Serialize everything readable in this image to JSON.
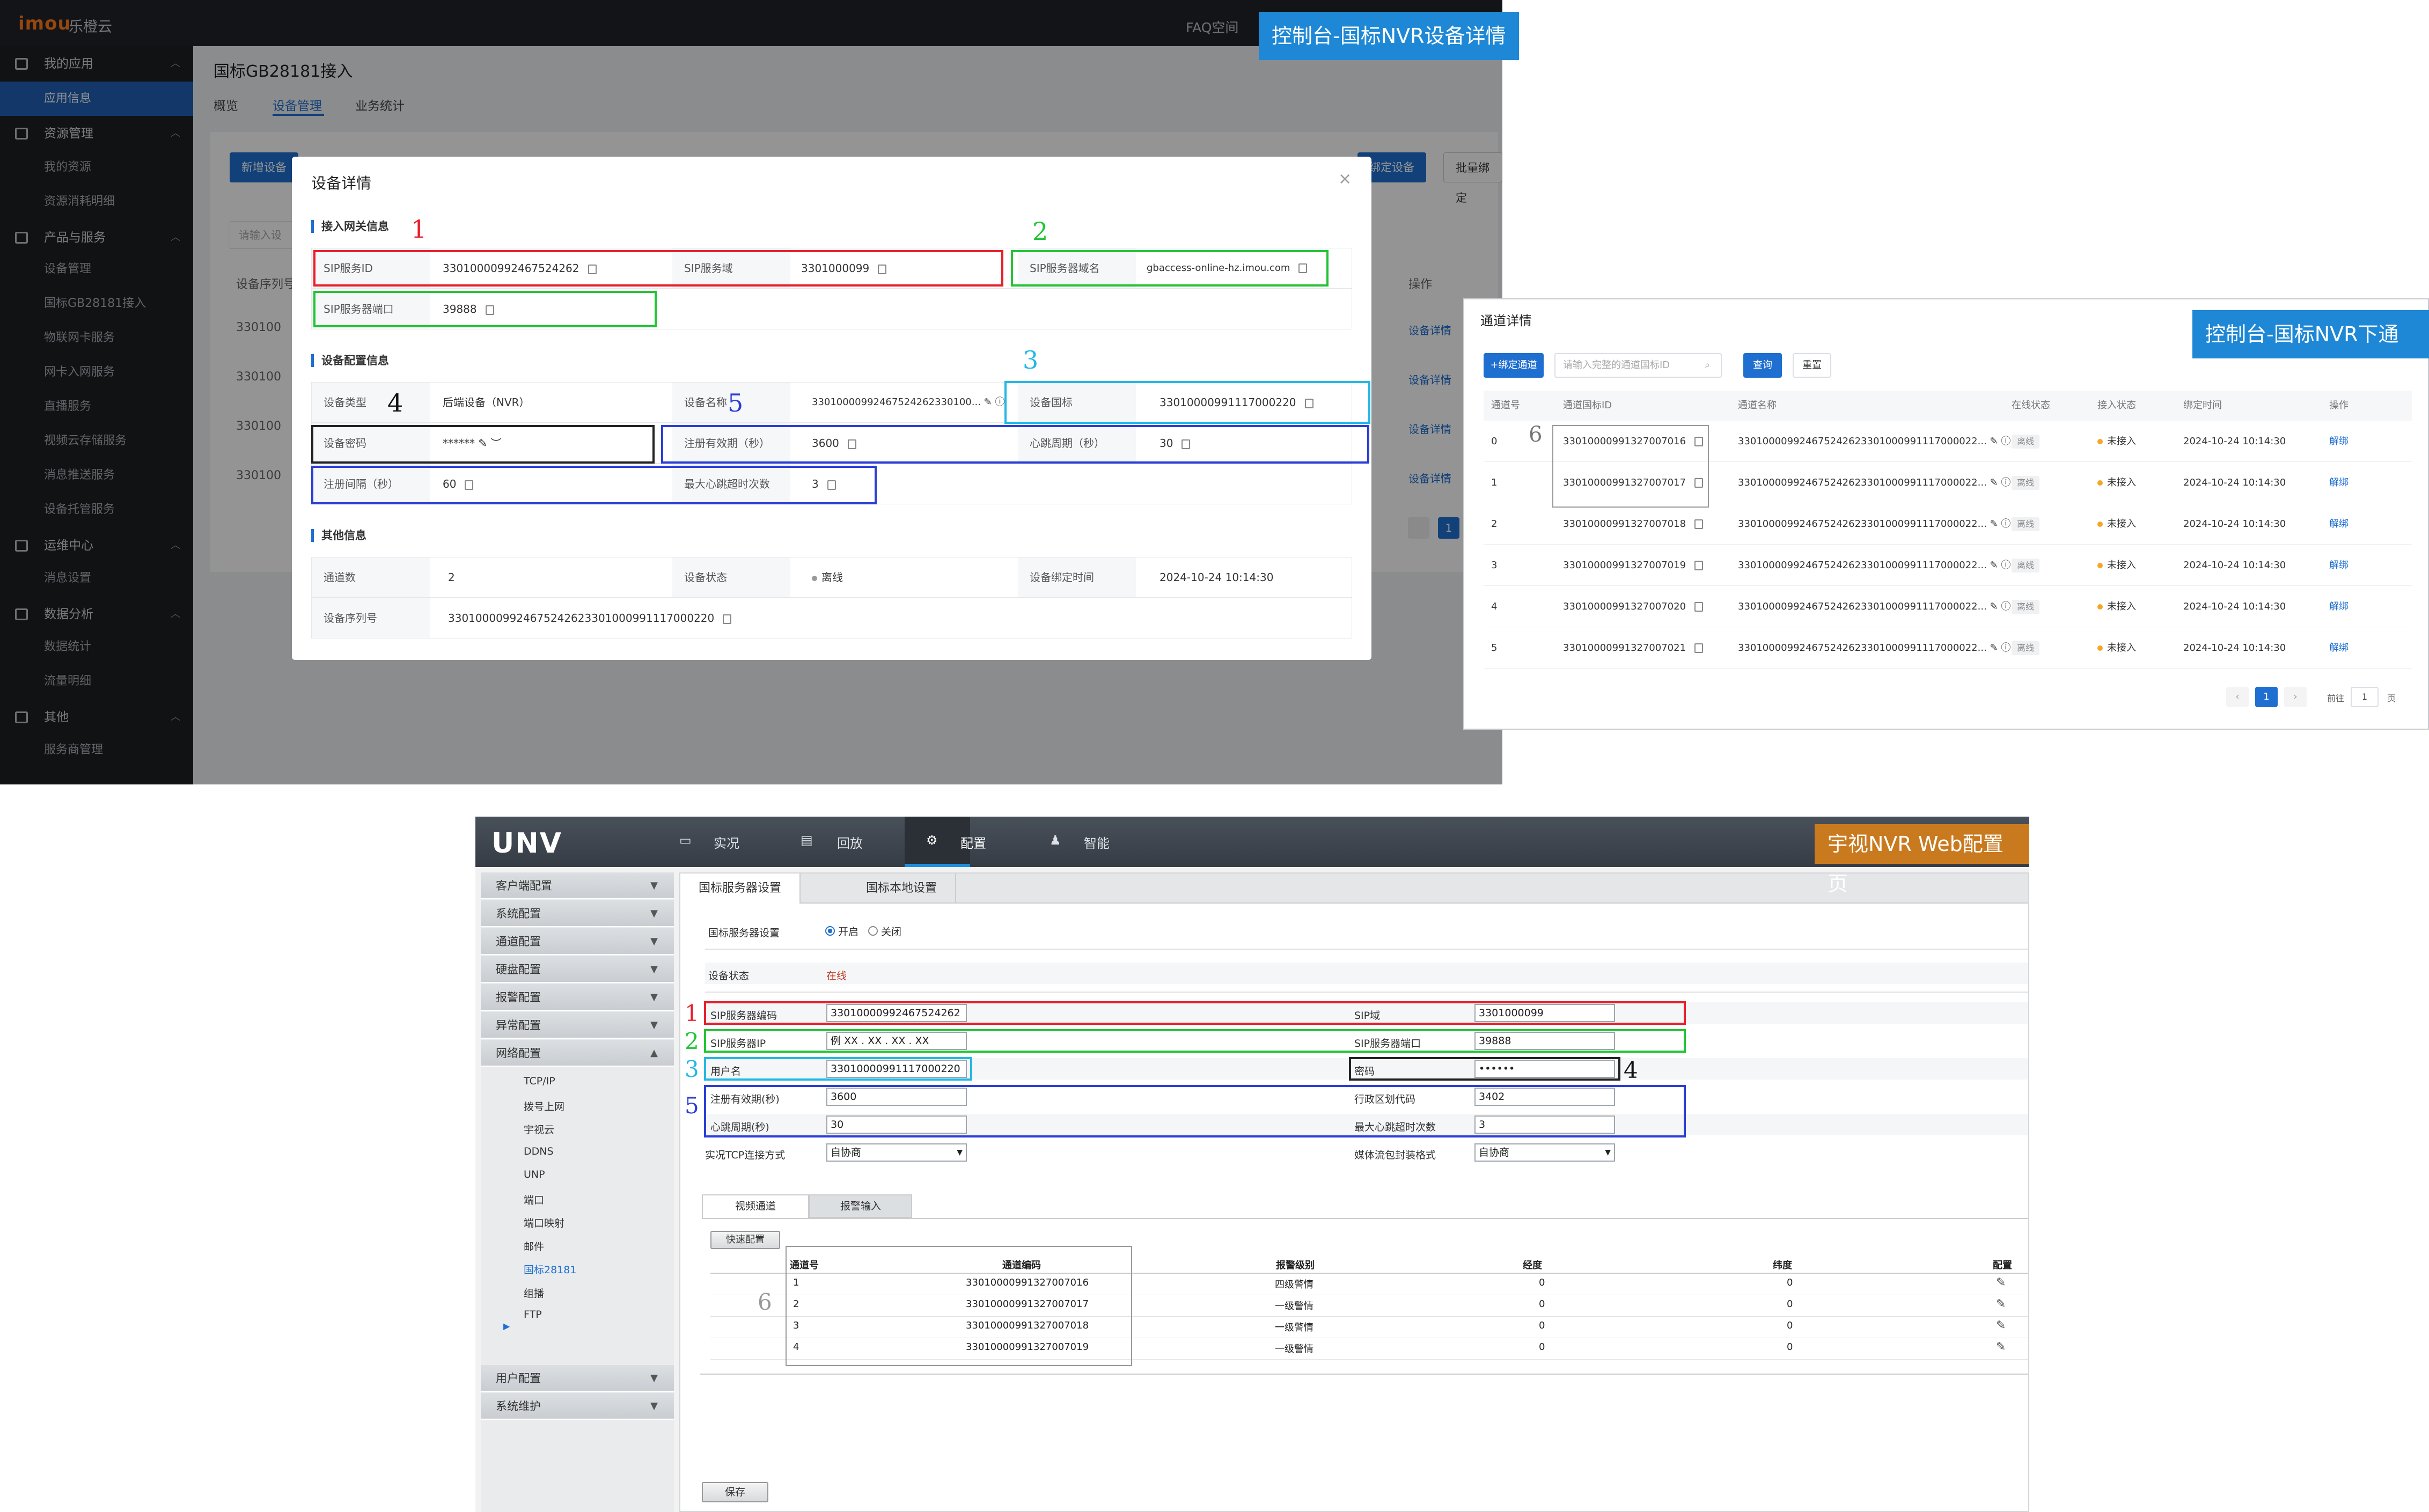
{
  "captions": {
    "a": "控制台-国标NVR设备详情",
    "b": "控制台-国标NVR下通道详情",
    "c": "宇视NVR Web配置页"
  },
  "console": {
    "logo": "imou",
    "brand": "乐橙云",
    "faq": "FAQ空间",
    "sidebar": {
      "groups": [
        {
          "label": "我的应用",
          "items": [
            "应用信息"
          ]
        },
        {
          "label": "资源管理",
          "items": [
            "我的资源",
            "资源消耗明细"
          ]
        },
        {
          "label": "产品与服务",
          "items": [
            "设备管理",
            "国标GB28181接入",
            "物联网卡服务",
            "网卡入网服务",
            "直播服务",
            "视频云存储服务",
            "消息推送服务",
            "设备托管服务"
          ]
        },
        {
          "label": "运维中心",
          "items": [
            "消息设置"
          ]
        },
        {
          "label": "数据分析",
          "items": [
            "数据统计",
            "流量明细"
          ]
        },
        {
          "label": "其他",
          "items": [
            "服务商管理"
          ]
        }
      ]
    },
    "page_title": "国标GB28181接入",
    "tabs": [
      "概览",
      "设备管理",
      "业务统计"
    ],
    "bg_buttons": [
      "新增设备",
      "绑定设备",
      "批量绑定"
    ],
    "bg_search_placeholder": "请输入设",
    "bg_column": "设备序列号",
    "bg_op_column": "操作",
    "bg_rows": [
      "330100",
      "330100",
      "330100",
      "330100"
    ],
    "bg_row_link": "设备详情",
    "bg_page": "1"
  },
  "modal": {
    "title": "设备详情",
    "close": "×",
    "sec1": "接入网关信息",
    "sip_server_id_label": "SIP服务ID",
    "sip_server_id": "33010000992467524262",
    "sip_domain_label": "SIP服务域",
    "sip_domain": "3301000099",
    "sip_server_host_label": "SIP服务器域名",
    "sip_server_host": "gbaccess-online-hz.imou.com",
    "sip_port_label": "SIP服务器端口",
    "sip_port": "39888",
    "sec2": "设备配置信息",
    "device_type_label": "设备类型",
    "device_type": "后端设备（NVR）",
    "device_name_label": "设备名称",
    "device_name": "33010000992467524262330100...",
    "device_gbid_label": "设备国标",
    "device_gbid": "33010000991117000220",
    "device_pwd_label": "设备密码",
    "device_pwd": "******",
    "reg_valid_label": "注册有效期（秒）",
    "reg_valid": "3600",
    "heartbeat_label": "心跳周期（秒）",
    "heartbeat": "30",
    "reg_period_label": "注册间隔（秒）",
    "reg_period": "60",
    "max_hb_label": "最大心跳超时次数",
    "max_hb": "3",
    "sec3": "其他信息",
    "channels_label": "通道数",
    "channels": "2",
    "status_label": "设备状态",
    "status": "离线",
    "bind_time_label": "设备绑定时间",
    "bind_time": "2024-10-24 10:14:30",
    "serial_label": "设备序列号",
    "serial": "330100009924675242623301000991117000220"
  },
  "markers": {
    "m1": "1",
    "m2": "2",
    "m3": "3",
    "m4": "4",
    "m5": "5",
    "m6": "6"
  },
  "channels": {
    "title": "通道详情",
    "bind_button": "+绑定通道",
    "search_placeholder": "请输入完整的通道国标ID",
    "query_button": "查询",
    "reset_button": "重置",
    "headers": [
      "通道号",
      "通道国标ID",
      "通道名称",
      "在线状态",
      "接入状态",
      "绑定时间",
      "操作"
    ],
    "rows": [
      {
        "no": "0",
        "id": "33010000991327007016",
        "name": "330100009924675242623301000991117000022...",
        "online": "离线",
        "access": "未接入",
        "time": "2024-10-24 10:14:30",
        "op": "解绑"
      },
      {
        "no": "1",
        "id": "33010000991327007017",
        "name": "330100009924675242623301000991117000022...",
        "online": "离线",
        "access": "未接入",
        "time": "2024-10-24 10:14:30",
        "op": "解绑"
      },
      {
        "no": "2",
        "id": "33010000991327007018",
        "name": "330100009924675242623301000991117000022...",
        "online": "离线",
        "access": "未接入",
        "time": "2024-10-24 10:14:30",
        "op": "解绑"
      },
      {
        "no": "3",
        "id": "33010000991327007019",
        "name": "330100009924675242623301000991117000022...",
        "online": "离线",
        "access": "未接入",
        "time": "2024-10-24 10:14:30",
        "op": "解绑"
      },
      {
        "no": "4",
        "id": "33010000991327007020",
        "name": "330100009924675242623301000991117000022...",
        "online": "离线",
        "access": "未接入",
        "time": "2024-10-24 10:14:30",
        "op": "解绑"
      },
      {
        "no": "5",
        "id": "33010000991327007021",
        "name": "330100009924675242623301000991117000022...",
        "online": "离线",
        "access": "未接入",
        "time": "2024-10-24 10:14:30",
        "op": "解绑"
      }
    ],
    "page": "1",
    "goto_label": "前往",
    "goto_value": "1",
    "page_suffix": "页"
  },
  "nvr": {
    "logo": "UNV",
    "nav": [
      "实况",
      "回放",
      "配置",
      "智能"
    ],
    "side_groups_top": [
      "客户端配置",
      "系统配置",
      "通道配置",
      "硬盘配置",
      "报警配置",
      "异常配置",
      "网络配置"
    ],
    "side_items": [
      "TCP/IP",
      "拨号上网",
      "宇视云",
      "DDNS",
      "UNP",
      "端口",
      "端口映射",
      "邮件",
      "国标28181",
      "组播",
      "FTP"
    ],
    "side_groups_bottom": [
      "用户配置",
      "系统维护"
    ],
    "tabs": [
      "国标服务器设置",
      "国标本地设置"
    ],
    "server_setting_label": "国标服务器设置",
    "on_label": "开启",
    "off_label": "关闭",
    "status_label": "设备状态",
    "status": "在线",
    "sip_code_label": "SIP服务器编码",
    "sip_code": "33010000992467524262",
    "sip_domain_label": "SIP域",
    "sip_domain": "3301000099",
    "sip_ip_label": "SIP服务器IP",
    "sip_ip": "例 XX . XX . XX . XX",
    "sip_port_label": "SIP服务器端口",
    "sip_port": "39888",
    "user_label": "用户名",
    "user": "33010000991117000220",
    "pwd_label": "密码",
    "pwd": "••••••",
    "reg_valid_label": "注册有效期(秒)",
    "reg_valid": "3600",
    "region_label": "行政区划代码",
    "region": "3402",
    "hb_label": "心跳周期(秒)",
    "hb": "30",
    "max_hb_label": "最大心跳超时次数",
    "max_hb": "3",
    "tcp_label": "实况TCP连接方式",
    "tcp": "自协商",
    "stream_label": "媒体流包封装格式",
    "stream": "自协商",
    "sub_tabs": [
      "视频通道",
      "报警输入"
    ],
    "quick_button": "快速配置",
    "table_headers": [
      "通道号",
      "通道编码",
      "报警级别",
      "经度",
      "纬度",
      "配置"
    ],
    "table_rows": [
      {
        "no": "1",
        "code": "33010000991327007016",
        "level": "四级警情",
        "lng": "0",
        "lat": "0"
      },
      {
        "no": "2",
        "code": "33010000991327007017",
        "level": "一级警情",
        "lng": "0",
        "lat": "0"
      },
      {
        "no": "3",
        "code": "33010000991327007018",
        "level": "一级警情",
        "lng": "0",
        "lat": "0"
      },
      {
        "no": "4",
        "code": "33010000991327007019",
        "level": "一级警情",
        "lng": "0",
        "lat": "0"
      }
    ],
    "save_button": "保存"
  }
}
